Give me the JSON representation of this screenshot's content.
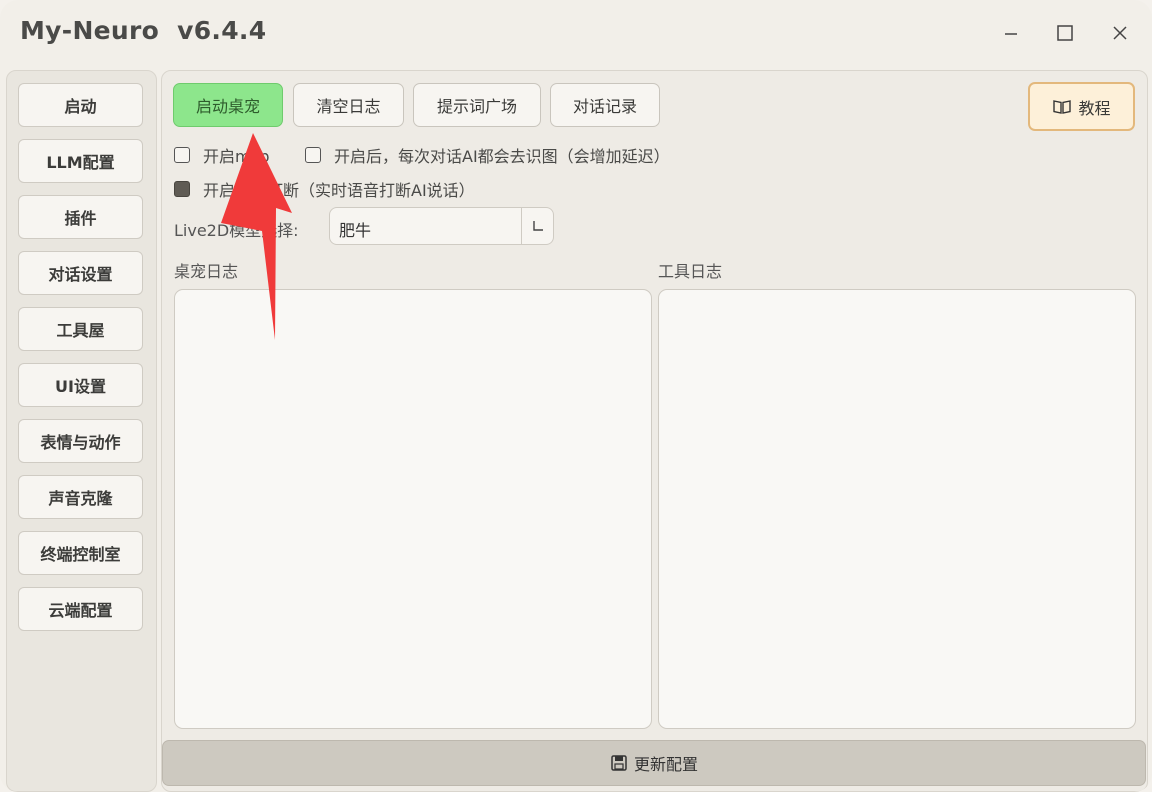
{
  "app": {
    "title": "My-Neuro  v6.4.4"
  },
  "sidebar": {
    "items": [
      {
        "label": "启动"
      },
      {
        "label": "LLM配置"
      },
      {
        "label": "插件"
      },
      {
        "label": "对话设置"
      },
      {
        "label": "工具屋"
      },
      {
        "label": "UI设置"
      },
      {
        "label": "表情与动作"
      },
      {
        "label": "声音克隆"
      },
      {
        "label": "终端控制室"
      },
      {
        "label": "云端配置"
      }
    ]
  },
  "toolbar": {
    "start_pet": "启动桌宠",
    "clear_log": "清空日志",
    "prompt_plaza": "提示词广场",
    "chat_history": "对话记录",
    "tutorial": "教程"
  },
  "options": {
    "mcp": {
      "label": "开启mcp",
      "checked": false
    },
    "vision": {
      "label": "开启后，每次对话AI都会去识图（会增加延迟）",
      "checked": false
    },
    "interrupt": {
      "label": "开启语音打断（实时语音打断AI说话）",
      "checked": true
    }
  },
  "model_select": {
    "label": "Live2D模型选择:",
    "value": "肥牛"
  },
  "logs": {
    "pet_log_title": "桌宠日志",
    "tool_log_title": "工具日志"
  },
  "footer": {
    "update_label": "更新配置"
  },
  "colors": {
    "accent_green": "#8de68c",
    "annotation_arrow": "#f03a3a",
    "tutorial_border": "#e3b87c"
  }
}
